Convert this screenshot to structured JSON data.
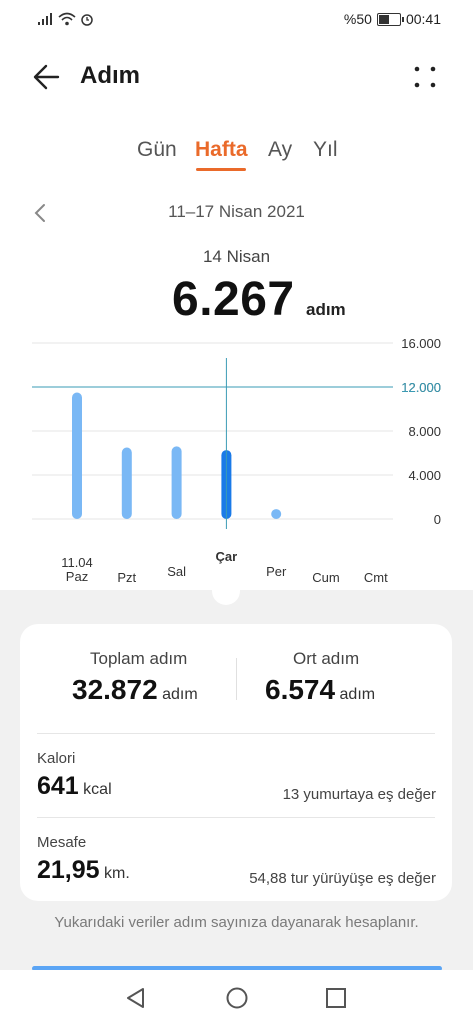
{
  "status_bar": {
    "battery_text": "%50",
    "time": "00:41"
  },
  "header": {
    "title": "Adım",
    "back_icon": "back-arrow-icon",
    "menu_icon": "more-vertical-icon"
  },
  "tabs": [
    {
      "label": "Gün",
      "active": false
    },
    {
      "label": "Hafta",
      "active": true
    },
    {
      "label": "Ay",
      "active": false
    },
    {
      "label": "Yıl",
      "active": false
    }
  ],
  "date_range": "11–17 Nisan 2021",
  "selected": {
    "date": "14 Nisan",
    "value": "6.267",
    "unit": "adım"
  },
  "chart_data": {
    "type": "bar",
    "categories": [
      "Paz",
      "Pzt",
      "Sal",
      "Çar",
      "Per",
      "Cum",
      "Cmt"
    ],
    "first_date_label": "11.04",
    "values": [
      11500,
      6500,
      6600,
      6267,
      900,
      0,
      0
    ],
    "selected_index": 3,
    "ylim": [
      0,
      16000
    ],
    "yticks": [
      "16.000",
      "12.000",
      "8.000",
      "4.000",
      "0"
    ],
    "goal_line": 12000,
    "goal_label": "12.000",
    "bar_color": "#7ab8f5",
    "selected_color": "#1a7ae8",
    "goal_color": "#3a9bb5"
  },
  "summary": {
    "total_label": "Toplam adım",
    "total_value": "32.872",
    "total_unit": "adım",
    "avg_label": "Ort adım",
    "avg_value": "6.574",
    "avg_unit": "adım",
    "calories_label": "Kalori",
    "calories_value": "641",
    "calories_unit": "kcal",
    "calories_note": "13 yumurtaya eş değer",
    "distance_label": "Mesafe",
    "distance_value": "21,95",
    "distance_unit": "km.",
    "distance_note": "54,88 tur yürüyüşe eş değer"
  },
  "footnote": "Yukarıdaki veriler adım sayınıza dayanarak hesaplanır.",
  "nav": {
    "back": "nav-back-icon",
    "home": "nav-home-icon",
    "recents": "nav-recents-icon"
  }
}
